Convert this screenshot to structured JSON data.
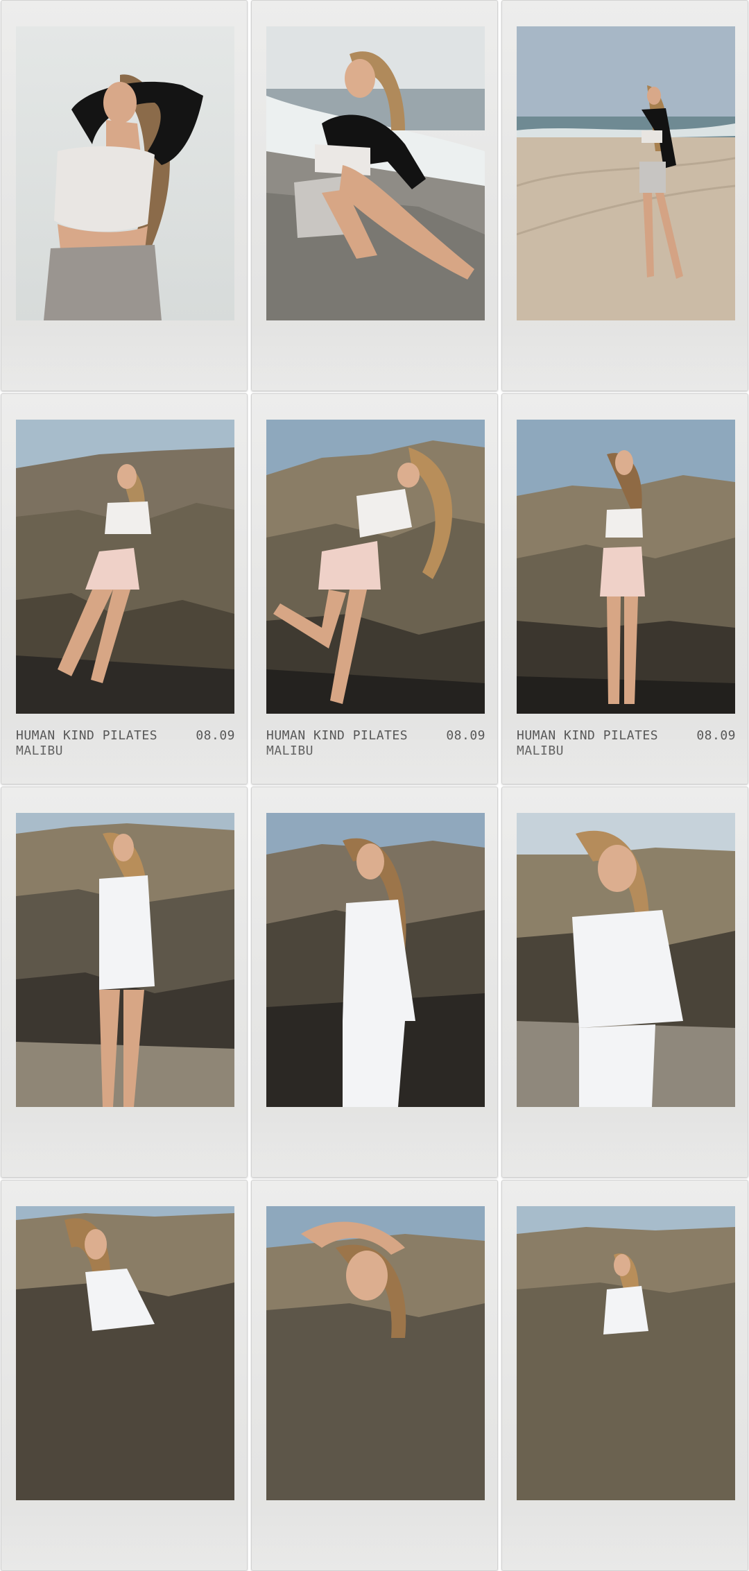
{
  "gallery": {
    "cards": [
      {
        "alt_scene": "fog",
        "caption": null
      },
      {
        "alt_scene": "ocean-rock",
        "caption": null
      },
      {
        "alt_scene": "beach",
        "caption": null
      },
      {
        "alt_scene": "rocks-pink",
        "caption": {
          "location": "HUMAN KIND PILATES MALIBU",
          "date": "08.09"
        }
      },
      {
        "alt_scene": "rocks-pink",
        "caption": {
          "location": "HUMAN KIND PILATES MALIBU",
          "date": "08.09"
        }
      },
      {
        "alt_scene": "rocks-pink",
        "caption": {
          "location": "HUMAN KIND PILATES MALIBU",
          "date": "08.09"
        }
      },
      {
        "alt_scene": "rocks-white",
        "caption": null
      },
      {
        "alt_scene": "rocks-white",
        "caption": null
      },
      {
        "alt_scene": "rocks-white",
        "caption": null
      },
      {
        "alt_scene": "rocks-white",
        "caption": null
      },
      {
        "alt_scene": "rocks-white",
        "caption": null
      },
      {
        "alt_scene": "rocks-white",
        "caption": null
      }
    ]
  },
  "colors": {
    "card_bg": "#e8e8e7",
    "caption_text": "#4a4a4a",
    "sky": "#9fb6c8",
    "rock": "#6b6250",
    "sand": "#c9b8a3"
  }
}
